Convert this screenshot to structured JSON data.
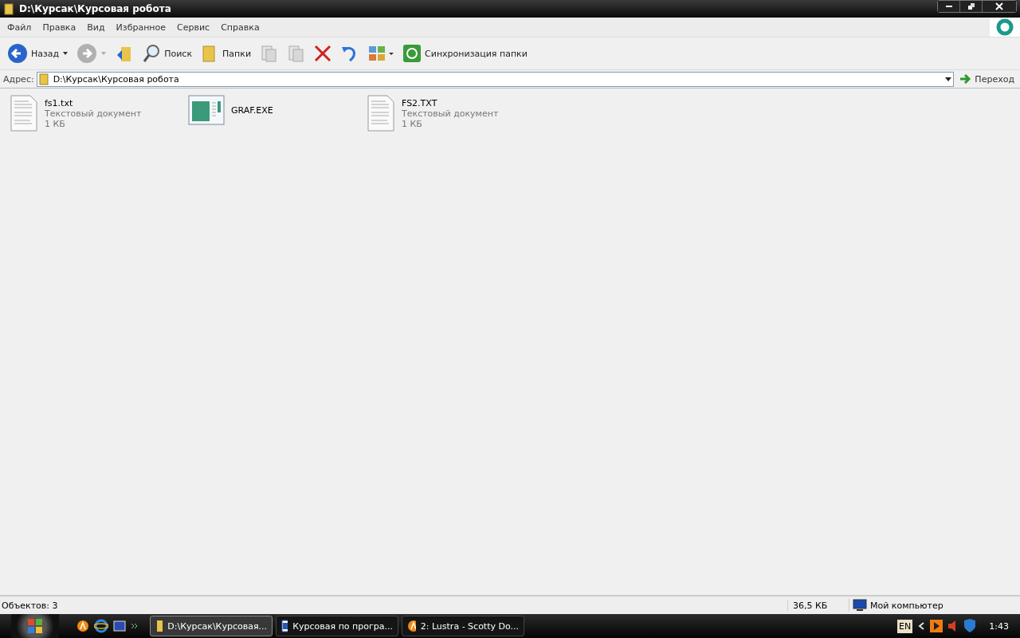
{
  "window": {
    "title": "D:\\Курсак\\Курсовая робота"
  },
  "menu": [
    "Файл",
    "Правка",
    "Вид",
    "Избранное",
    "Сервис",
    "Справка"
  ],
  "toolbar": [
    {
      "kind": "back",
      "label": "Назад"
    },
    {
      "kind": "forward"
    },
    {
      "kind": "up"
    },
    {
      "kind": "search",
      "label": "Поиск"
    },
    {
      "kind": "folders",
      "label": "Папки"
    },
    {
      "kind": "move"
    },
    {
      "kind": "copy"
    },
    {
      "kind": "delete"
    },
    {
      "kind": "undo"
    },
    {
      "kind": "views"
    },
    {
      "kind": "sync",
      "label": "Синхронизация папки"
    }
  ],
  "address": {
    "label": "Адрес:",
    "value": "D:\\Курсак\\Курсовая робота",
    "go": "Переход"
  },
  "files": [
    {
      "kind": "text",
      "name": "fs1.txt",
      "type": "Текстовый документ",
      "size": "1 КБ"
    },
    {
      "kind": "exe",
      "name": "GRAF.EXE"
    },
    {
      "kind": "text",
      "name": "FS2.TXT",
      "type": "Текстовый документ",
      "size": "1 КБ"
    }
  ],
  "status_bar": {
    "objects": "Объектов: 3",
    "size": "36,5 КБ",
    "location": "Мой компьютер"
  },
  "taskbar": {
    "buttons": [
      {
        "kind": "folder",
        "label": "D:\\Курсак\\Курсовая...",
        "selected": true
      },
      {
        "kind": "word",
        "label": "Курсовая по програ...",
        "selected": false
      },
      {
        "kind": "player",
        "label": "2: Lustra - Scotty Do...",
        "selected": false
      }
    ],
    "language": "EN",
    "clock": "1:43"
  }
}
